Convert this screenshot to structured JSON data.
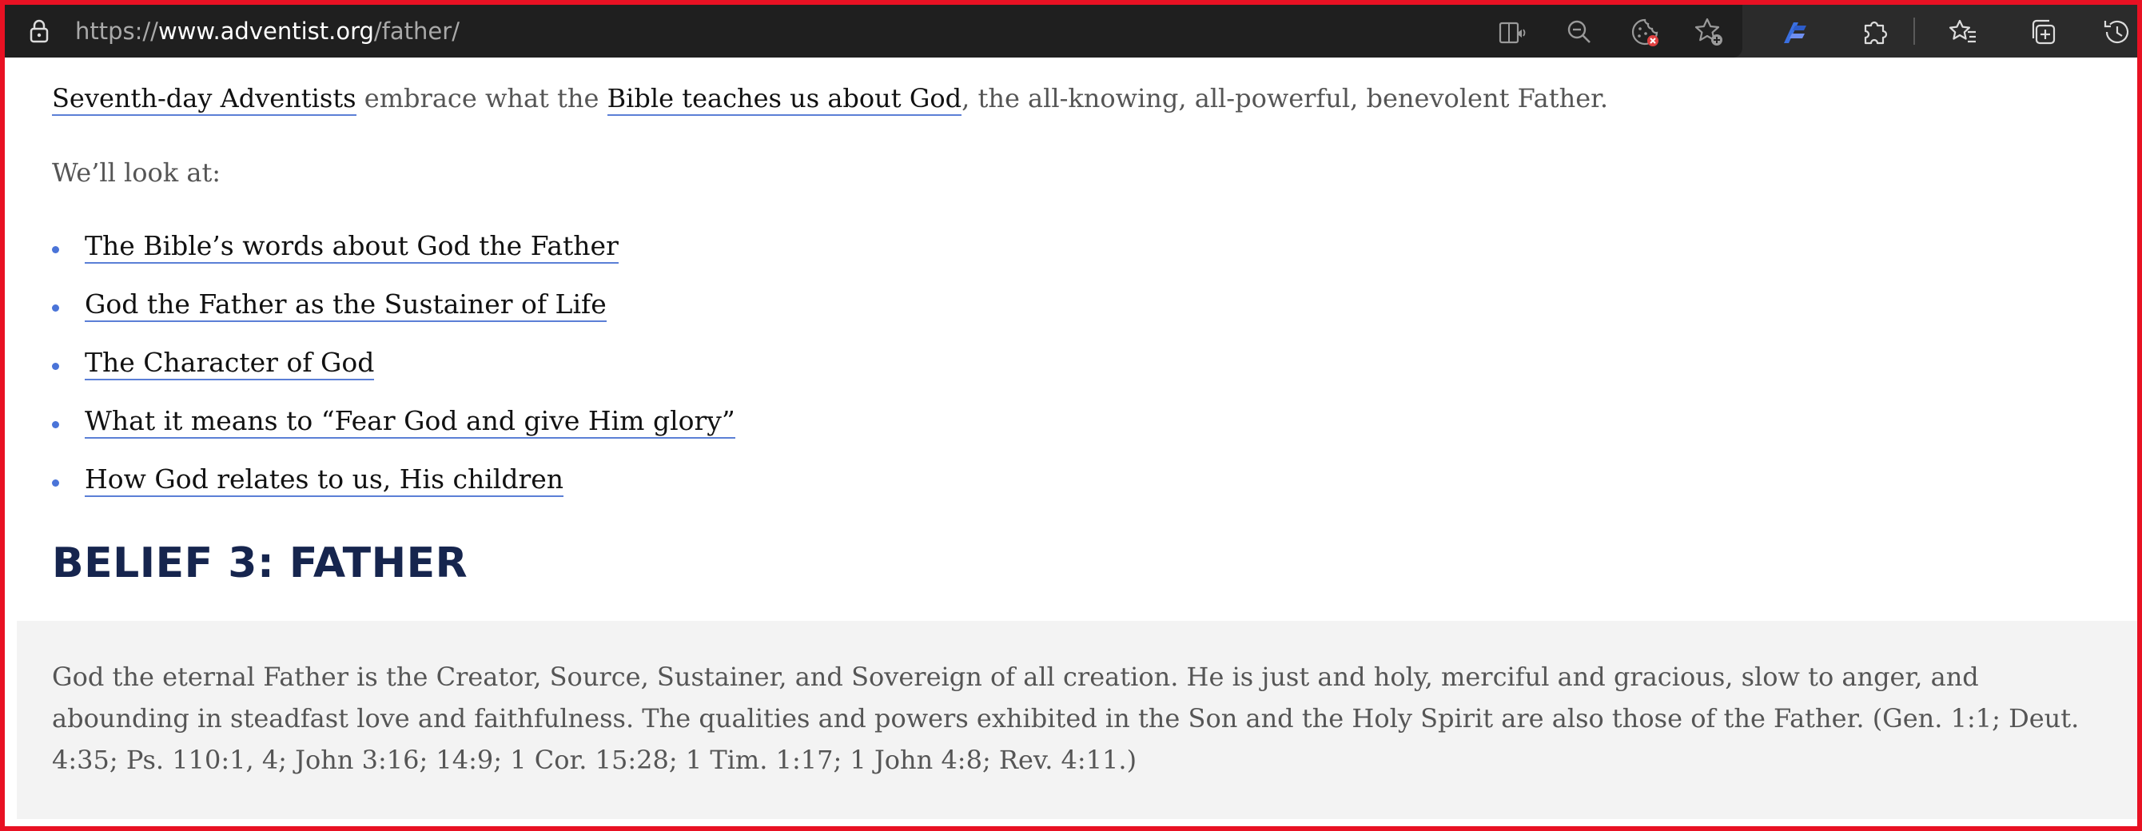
{
  "browser": {
    "url_prefix": "https://",
    "url_host": "www.adventist.org",
    "url_path": "/father/",
    "icons": [
      "lock-icon",
      "immersive-reader-icon",
      "zoom-out-icon",
      "tracking-prevention-icon",
      "add-favorite-icon",
      "copilot-icon",
      "extensions-icon",
      "favorites-icon",
      "collections-icon",
      "history-icon"
    ]
  },
  "intro": {
    "link1": "Seventh-day Adventists",
    "text1": " embrace what the ",
    "link2": "Bible teaches us about God",
    "text2": ", the all-knowing, all-powerful, benevolent Father."
  },
  "look_at": "We’ll look at:",
  "topics": [
    "The Bible’s words about God the Father",
    "God the Father as the Sustainer of Life",
    "The Character of God",
    "What it means to “Fear God and give Him glory”",
    "How God relates to us, His children"
  ],
  "belief": {
    "heading": "BELIEF 3: FATHER",
    "text": "God the eternal Father is the Creator, Source, Sustainer, and Sovereign of all creation. He is just and holy, merciful and gracious, slow to anger, and abounding in steadfast love and faithfulness. The qualities and powers exhibited in the Son and the Holy Spirit are also those of the Father. (Gen. 1:1; Deut. 4:35; Ps. 110:1, 4; John 3:16; 14:9; 1 Cor. 15:28; 1 Tim. 1:17; 1 John 4:8; Rev. 4:11.)"
  },
  "colors": {
    "link_underline": "#5b7fd6",
    "bullet": "#4a74d8",
    "heading": "#16254e",
    "belief_box": "#f3f3f3",
    "window_border": "#e81123"
  }
}
